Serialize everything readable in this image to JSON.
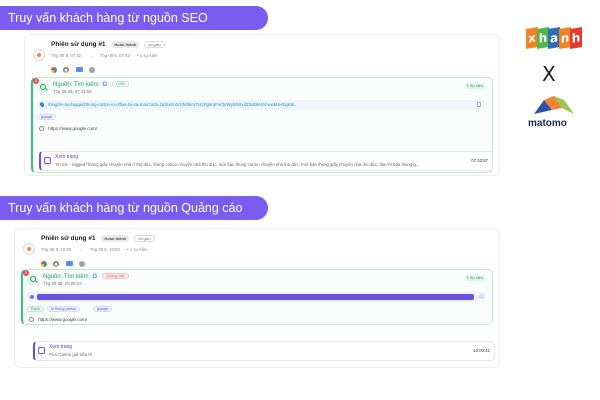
{
  "banners": {
    "seo": "Truy vấn khách hàng từ nguồn SEO",
    "ads": "Truy vấn khách hàng từ nguồn Quảng cáo"
  },
  "logos": {
    "fpt_letters": [
      "x",
      "h",
      "a",
      "n",
      "h"
    ],
    "separator": "X",
    "analytics": "matomo"
  },
  "seo_panel": {
    "session": {
      "title": "Phiên sử dụng #1",
      "status": "Hoàn thành",
      "vip": "vô gửu",
      "start": "Thg 08 8, 07:42",
      "end": "Thg 08 8, 07:42",
      "events": "• 1 sự kiện"
    },
    "event": {
      "notif": "1",
      "source_label": "Nguồn: Tìm kiếm",
      "engine": "G",
      "chip": "• Mới",
      "time": "Thg 08 08, 07:42:58",
      "count": "1 Sự kiện",
      "url": "/blog/tin-tuc/tagged/thung-carton-in-offset-tai-ca-mau?ord=1&hIxEn0rz(M3kcsTI4zPg6raFw7jeWyBNmufZ5x59AFKIwwMxHEgK9L",
      "tag": "google",
      "referrer": "https://www.google.com/"
    },
    "view": {
      "title": "Xem trang",
      "desc": "Tin tức - tagged \"thùng giấy chuyển nhà ở thủ đức, thùng carton chuyển nhà thủ đức, mời bán thùng carton chuyển nhà thủ đức, mời bán thùng giấy chuyển nhà thủ đức, địa chỉ bán thùng g...",
      "time": "07:42:57"
    }
  },
  "ads_panel": {
    "session": {
      "title": "Phiên sử dụng #1",
      "status": "Hoàn thành",
      "vip": "vô gửu",
      "start": "Thg 08 8, 10:00",
      "end": "Thg 08 8, 10:00",
      "events": "• 1 sự kiện"
    },
    "event": {
      "notif": "1",
      "source_label": "Nguồn: Tìm kiếm",
      "engine": "G",
      "chip": "Quảng cáo",
      "time": "Thg 08 08, 10:00:42",
      "count": "1 Sự kiện",
      "tags": [
        "Rạch",
        "in thùng carton",
        "google"
      ],
      "referrer": "https://www.google.com/"
    },
    "view": {
      "title": "Xem trang",
      "desc": "Pics Carton giá siêu rẻ",
      "time": "10:00:41"
    }
  },
  "colors": {
    "banner": "#7b5cf0",
    "event_accent": "#34c184",
    "view_accent": "#6a4ee6",
    "fpt_orange": "#f58220",
    "fpt_green": "#4fb848",
    "fpt_blue": "#2c6fb7"
  }
}
